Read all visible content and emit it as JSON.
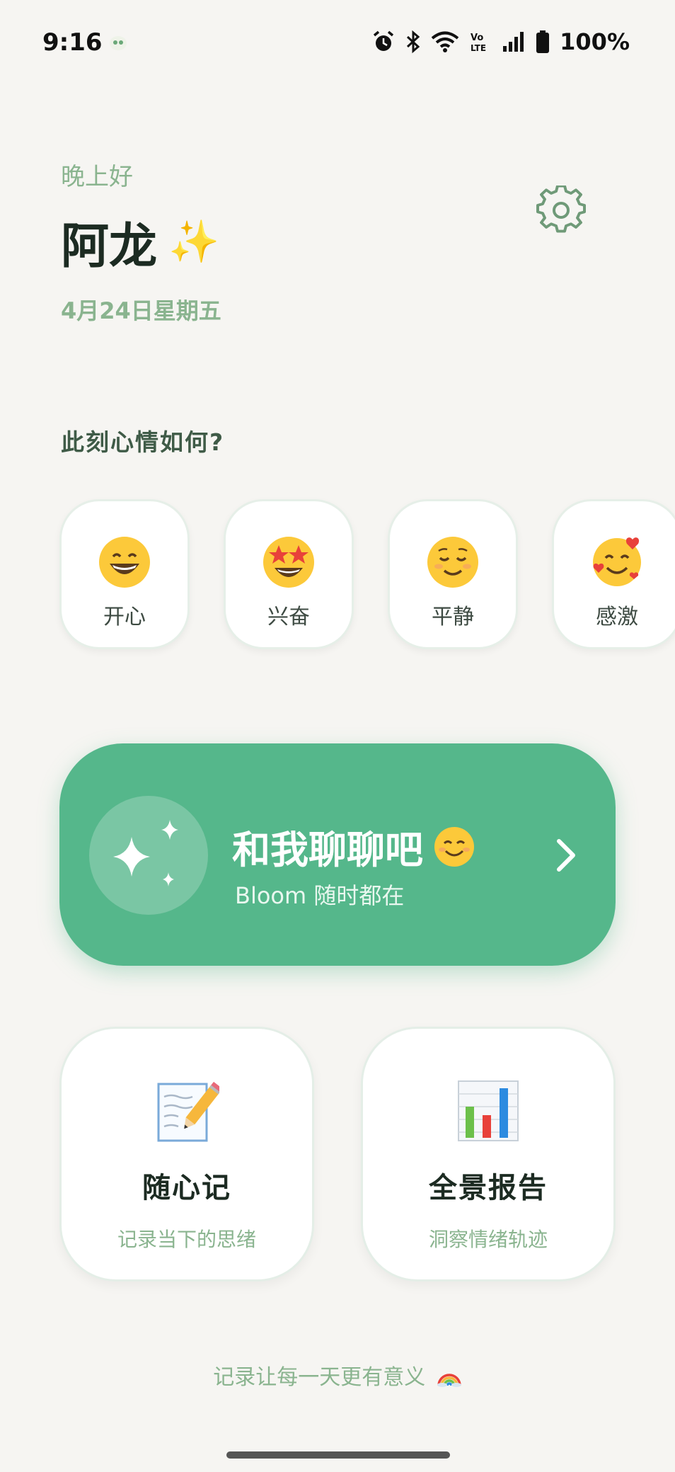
{
  "status_bar": {
    "time": "9:16",
    "battery": "100%"
  },
  "header": {
    "greeting": "晚上好",
    "name": "阿龙",
    "name_emoji": "✨",
    "date": "4月24日星期五"
  },
  "mood": {
    "question": "此刻心情如何?",
    "items": [
      {
        "label": "开心",
        "icon": "grinning-face-icon"
      },
      {
        "label": "兴奋",
        "icon": "star-struck-face-icon"
      },
      {
        "label": "平静",
        "icon": "relieved-face-icon"
      },
      {
        "label": "感激",
        "icon": "smiling-face-with-hearts-icon"
      }
    ]
  },
  "chat": {
    "title": "和我聊聊吧",
    "subtitle": "Bloom 随时都在"
  },
  "features": [
    {
      "title": "随心记",
      "subtitle": "记录当下的思绪",
      "icon": "memo-icon"
    },
    {
      "title": "全景报告",
      "subtitle": "洞察情绪轨迹",
      "icon": "bar-chart-icon"
    }
  ],
  "footer": {
    "text": "记录让每一天更有意义"
  },
  "colors": {
    "accent": "#55b78b",
    "muted_green": "#8ab48f",
    "background": "#f6f5f2"
  }
}
